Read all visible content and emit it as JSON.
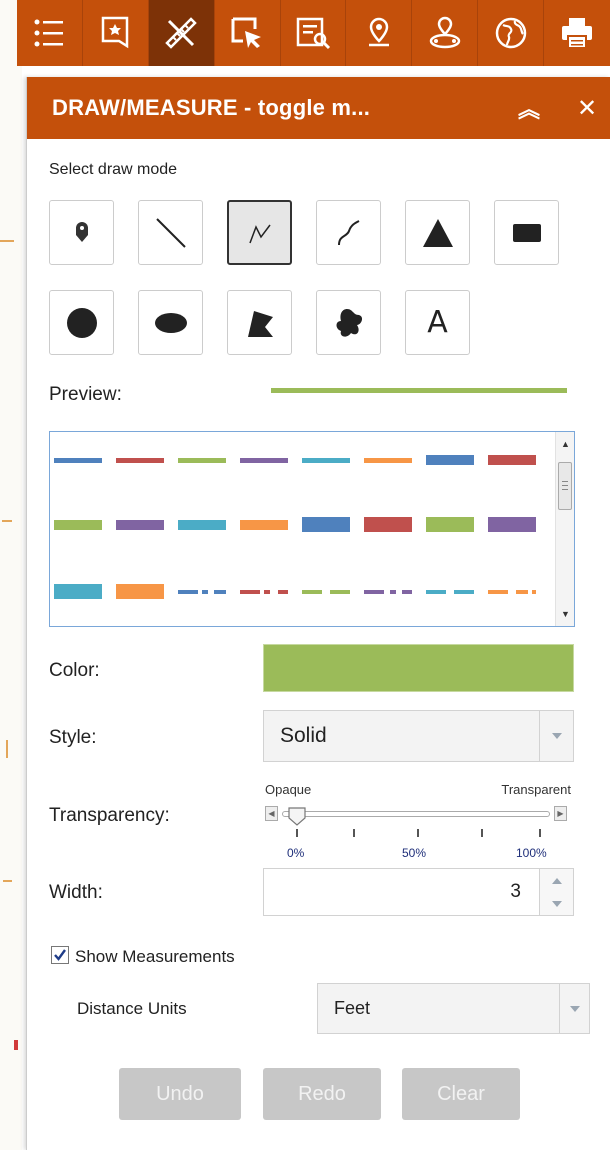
{
  "toolbar": {
    "tools": [
      {
        "icon": "layer-list-icon",
        "active": false
      },
      {
        "icon": "bookmark-icon",
        "active": false
      },
      {
        "icon": "draw-measure-icon",
        "active": true
      },
      {
        "icon": "select-icon",
        "active": false
      },
      {
        "icon": "query-icon",
        "active": false
      },
      {
        "icon": "location-pin-icon",
        "active": false
      },
      {
        "icon": "nearby-icon",
        "active": false
      },
      {
        "icon": "basemap-gallery-icon",
        "active": false
      },
      {
        "icon": "print-icon",
        "active": false
      }
    ]
  },
  "panel": {
    "title": "DRAW/MEASURE - toggle m...",
    "collapse_symbol": "︽",
    "close_symbol": "✕",
    "select_label": "Select draw mode",
    "draw_modes": [
      {
        "icon": "point-icon"
      },
      {
        "icon": "line-icon"
      },
      {
        "icon": "polyline-icon",
        "selected": true
      },
      {
        "icon": "freehand-polyline-icon"
      },
      {
        "icon": "triangle-icon"
      },
      {
        "icon": "rectangle-icon"
      },
      {
        "icon": "circle-icon"
      },
      {
        "icon": "ellipse-icon"
      },
      {
        "icon": "polygon-icon"
      },
      {
        "icon": "freehand-polygon-icon"
      },
      {
        "icon": "text-icon",
        "label": "A"
      }
    ],
    "preview_label": "Preview:",
    "preview_color": "#9bbb59",
    "line_styles": {
      "colors": [
        "#4f81bd",
        "#c0504d",
        "#9bbb59",
        "#8064a2",
        "#4bacc6",
        "#f79646"
      ],
      "rows": [
        "solid-thin",
        "solid-thick",
        "dash-dot"
      ]
    },
    "color_label": "Color:",
    "color_value": "#9bbb59",
    "style_label": "Style:",
    "style_value": "Solid",
    "transparency_label": "Transparency:",
    "transparency": {
      "min_label": "Opaque",
      "max_label": "Transparent",
      "value": 0,
      "ticks": [
        "0%",
        "50%",
        "100%"
      ]
    },
    "width_label": "Width:",
    "width_value": "3",
    "show_measurements_label": "Show Measurements",
    "show_measurements_checked": true,
    "distance_units_label": "Distance Units",
    "distance_units_value": "Feet",
    "buttons": {
      "undo": "Undo",
      "redo": "Redo",
      "clear": "Clear"
    }
  }
}
